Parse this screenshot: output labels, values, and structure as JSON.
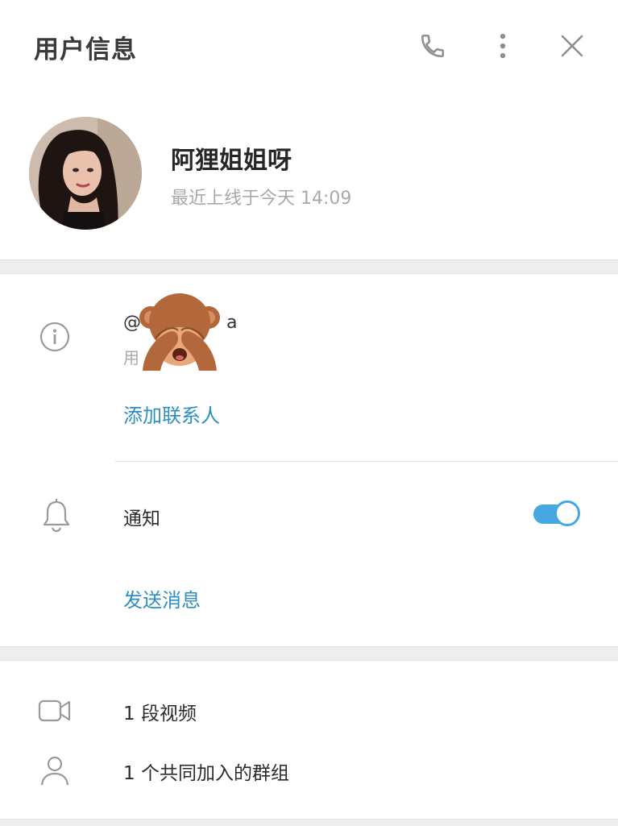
{
  "header": {
    "title": "用户信息"
  },
  "profile": {
    "name": "阿狸姐姐呀",
    "last_seen": "最近上线于今天 14:09"
  },
  "info": {
    "username_prefix": "@",
    "username_suffix": "a",
    "username_label": "用",
    "add_contact": "添加联系人"
  },
  "notifications": {
    "label": "通知",
    "enabled": true
  },
  "send_message": "发送消息",
  "media": {
    "videos": "1 段视频",
    "groups": "1 个共同加入的群组"
  },
  "colors": {
    "accent": "#2d8fbf",
    "toggle": "#47a7e0"
  }
}
